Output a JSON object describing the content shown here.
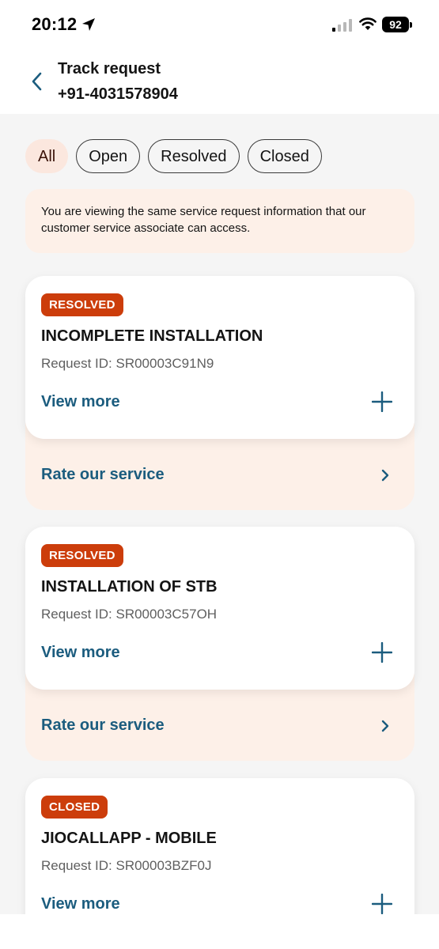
{
  "status_bar": {
    "time": "20:12",
    "battery": "92"
  },
  "header": {
    "title": "Track request",
    "subtitle": "+91-4031578904"
  },
  "filters": [
    {
      "label": "All",
      "active": true
    },
    {
      "label": "Open",
      "active": false
    },
    {
      "label": "Resolved",
      "active": false
    },
    {
      "label": "Closed",
      "active": false
    }
  ],
  "info_banner": "You are viewing the same service request information that our customer service associate can access.",
  "requests": [
    {
      "status": "RESOLVED",
      "title": "INCOMPLETE INSTALLATION",
      "request_id": "Request ID: SR00003C91N9",
      "view_more": "View more",
      "rate_label": "Rate our service"
    },
    {
      "status": "RESOLVED",
      "title": "INSTALLATION OF STB",
      "request_id": "Request ID: SR00003C57OH",
      "view_more": "View more",
      "rate_label": "Rate our service"
    },
    {
      "status": "CLOSED",
      "title": "JIOCALLAPP - MOBILE",
      "request_id": "Request ID: SR00003BZF0J",
      "view_more": "View more"
    }
  ],
  "colors": {
    "accent_blue": "#1b5c7e",
    "badge_red": "#cc3d0b",
    "peach": "#fdf0e8",
    "chip_active_bg": "#fbe7de"
  },
  "icons": {
    "back": "chevron-left-icon",
    "expand": "plus-icon",
    "rate": "chevron-right-icon",
    "location": "location-arrow-icon",
    "signal": "cellular-signal-icon",
    "wifi": "wifi-icon"
  }
}
